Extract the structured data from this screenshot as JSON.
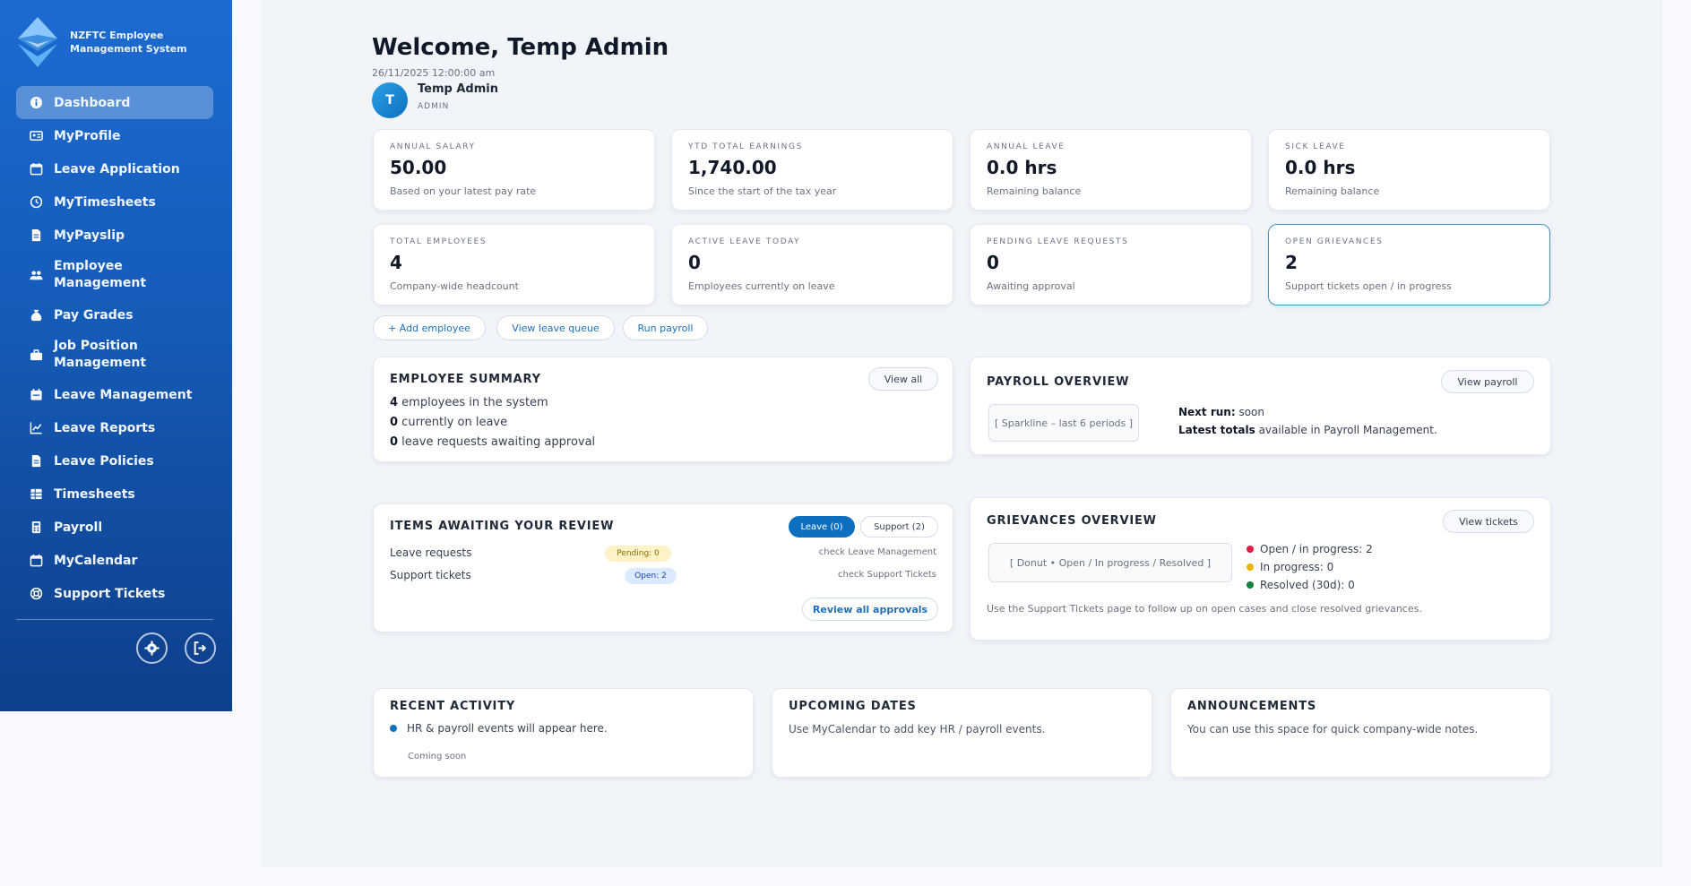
{
  "brand": {
    "line1": "NZFTC Employee",
    "line2": "Management System"
  },
  "nav": [
    {
      "label": "Dashboard",
      "icon": "info-icon",
      "active": true
    },
    {
      "label": "MyProfile",
      "icon": "id-card-icon"
    },
    {
      "label": "Leave Application",
      "icon": "calendar-icon"
    },
    {
      "label": "MyTimesheets",
      "icon": "clock-icon"
    },
    {
      "label": "MyPayslip",
      "icon": "document-icon"
    },
    {
      "label": "Employee\nManagement",
      "icon": "users-icon"
    },
    {
      "label": "Pay Grades",
      "icon": "money-bag-icon"
    },
    {
      "label": "Job Position\nManagement",
      "icon": "briefcase-icon"
    },
    {
      "label": "Leave Management",
      "icon": "calendar-check-icon"
    },
    {
      "label": "Leave Reports",
      "icon": "line-chart-icon"
    },
    {
      "label": "Leave Policies",
      "icon": "document-icon"
    },
    {
      "label": "Timesheets",
      "icon": "table-icon"
    },
    {
      "label": "Payroll",
      "icon": "calculator-icon"
    },
    {
      "label": "MyCalendar",
      "icon": "calendar-icon"
    },
    {
      "label": "Support Tickets",
      "icon": "lifebuoy-icon"
    }
  ],
  "header": {
    "welcome": "Welcome, Temp Admin",
    "date": "26/11/2025 12:00:00 am",
    "avatar_initial": "T",
    "user_name": "Temp Admin",
    "user_role": "ADMIN"
  },
  "stats": [
    {
      "label": "ANNUAL SALARY",
      "value": "50.00",
      "sub": "Based on your latest pay rate"
    },
    {
      "label": "YTD TOTAL EARNINGS",
      "value": "1,740.00",
      "sub": "Since the start of the tax year"
    },
    {
      "label": "ANNUAL LEAVE",
      "value": "0.0 hrs",
      "sub": "Remaining balance"
    },
    {
      "label": "SICK LEAVE",
      "value": "0.0 hrs",
      "sub": "Remaining balance"
    },
    {
      "label": "TOTAL EMPLOYEES",
      "value": "4",
      "sub": "Company-wide headcount"
    },
    {
      "label": "ACTIVE LEAVE TODAY",
      "value": "0",
      "sub": "Employees currently on leave"
    },
    {
      "label": "PENDING LEAVE REQUESTS",
      "value": "0",
      "sub": "Awaiting approval"
    },
    {
      "label": "OPEN GRIEVANCES",
      "value": "2",
      "sub": "Support tickets open / in progress"
    }
  ],
  "quick_actions": [
    "+ Add employee",
    "View leave queue",
    "Run payroll"
  ],
  "employee_summary": {
    "title": "EMPLOYEE SUMMARY",
    "button": "View all",
    "lines": [
      {
        "num": "4",
        "text": " employees in the system"
      },
      {
        "num": "0",
        "text": " currently on leave"
      },
      {
        "num": "0",
        "text": " leave requests awaiting approval"
      }
    ]
  },
  "payroll_overview": {
    "title": "PAYROLL OVERVIEW",
    "button": "View payroll",
    "placeholder": "[ Sparkline – last 6 periods ]",
    "next_run_label": "Next run:",
    "next_run_value": " soon",
    "latest_label": "Latest totals",
    "latest_value": " available in Payroll Management."
  },
  "review": {
    "title": "ITEMS AWAITING YOUR REVIEW",
    "tab_leave": "Leave (0)",
    "tab_support": "Support (2)",
    "rows": [
      {
        "label": "Leave requests",
        "badge": "Pending: 0",
        "link": "check Leave Management"
      },
      {
        "label": "Support tickets",
        "badge": "Open: 2",
        "link": "check Support Tickets"
      }
    ],
    "button": "Review all approvals"
  },
  "grievances": {
    "title": "GRIEVANCES OVERVIEW",
    "button": "View tickets",
    "placeholder": "[ Donut • Open / In progress / Resolved ]",
    "legend": [
      {
        "label": "Open / in progress: 2",
        "color": "#e11d48"
      },
      {
        "label": "In progress: 0",
        "color": "#eab308"
      },
      {
        "label": "Resolved (30d): 0",
        "color": "#15803d"
      }
    ],
    "note": "Use the Support Tickets page to follow up on open cases and close resolved grievances."
  },
  "recent_activity": {
    "title": "RECENT ACTIVITY",
    "item": "HR & payroll events will appear here.",
    "sub": "Coming soon"
  },
  "upcoming_dates": {
    "title": "UPCOMING DATES",
    "text": "Use MyCalendar to add key HR / payroll events."
  },
  "announcements": {
    "title": "ANNOUNCEMENTS",
    "text": "You can use this space for quick company-wide notes."
  },
  "colors": {
    "sidebar_top": "#1d6bd1",
    "sidebar_bottom": "#0e3f8a",
    "accent": "#0d6fbf",
    "pending_bg": "#fdf3c7",
    "open_bg": "#dbeafe"
  }
}
